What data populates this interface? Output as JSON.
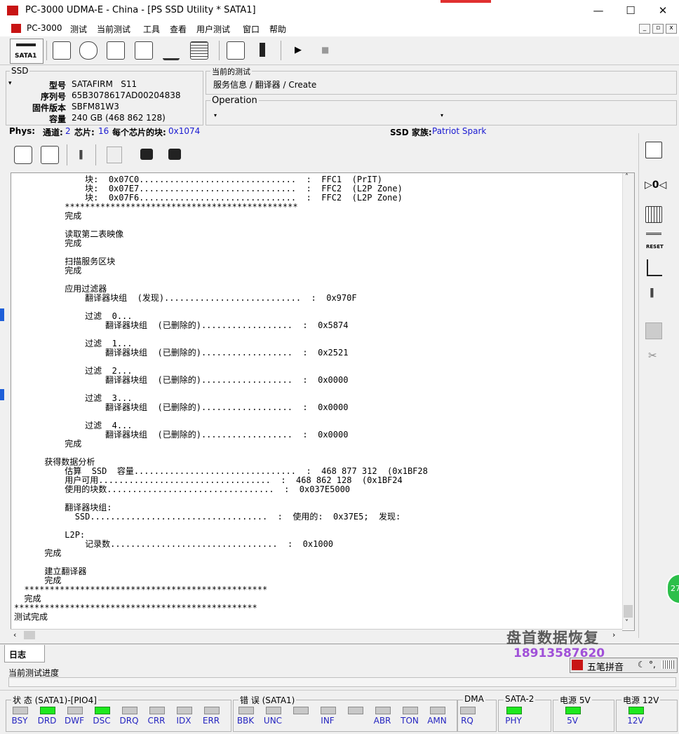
{
  "window": {
    "title": "PC-3000 UDMA-E - China - [PS SSD Utility * SATA1]",
    "minimize": "—",
    "maximize": "☐",
    "close": "✕"
  },
  "menu": [
    "PC-3000",
    "测试",
    "当前测试",
    "工具",
    "查看",
    "用户测试",
    "窗口",
    "帮助"
  ],
  "mdi_buttons": [
    "_",
    "▫",
    "x"
  ],
  "toolbar": {
    "port_label": "SATA1",
    "play": "▶",
    "stop": "■"
  },
  "ssd": {
    "group_label": "SSD",
    "fields": [
      {
        "label": "型号",
        "value": "SATAFIRM   S11"
      },
      {
        "label": "序列号",
        "value": "65B3078617AD00204838"
      },
      {
        "label": "固件版本",
        "value": "SBFM81W3"
      },
      {
        "label": "容量",
        "value": "240 GB (468 862 128)"
      }
    ]
  },
  "current_test": {
    "label": "当前的测试",
    "value": "服务信息 / 翻译器 / Create"
  },
  "operation": {
    "label": "Operation",
    "value": ""
  },
  "phys": {
    "label": "Phys:",
    "channels_label": "通道:",
    "channels": "2",
    "chips_label": "芯片:",
    "chips": "16",
    "blocks_label": "每个芯片的块:",
    "blocks": "0x1074",
    "family_label": "SSD 家族:",
    "family": "Patriot Spark"
  },
  "log_lines": [
    "              块:  0x07C0...............................  :  FFC1  (PrIT)",
    "              块:  0x07E7...............................  :  FFC2  (L2P Zone)",
    "              块:  0x07F6...............................  :  FFC2  (L2P Zone)",
    "          **********************************************",
    "          完成",
    "",
    "          读取第二表映像",
    "          完成",
    "",
    "          扫描服务区块",
    "          完成",
    "",
    "          应用过滤器",
    "              翻译器块组  (发现)...........................  :  0x970F",
    "",
    "              过滤  0...",
    "                  翻译器块组  (已删除的)..................  :  0x5874",
    "",
    "              过滤  1...",
    "                  翻译器块组  (已删除的)..................  :  0x2521",
    "",
    "              过滤  2...",
    "                  翻译器块组  (已删除的)..................  :  0x0000",
    "",
    "              过滤  3...",
    "                  翻译器块组  (已删除的)..................  :  0x0000",
    "",
    "              过滤  4...",
    "                  翻译器块组  (已删除的)..................  :  0x0000",
    "          完成",
    "",
    "      获得数据分析",
    "          估算  SSD  容量................................  :  468 877 312  (0x1BF28",
    "          用户可用..................................  :  468 862 128  (0x1BF24",
    "          使用的块数.................................  :  0x037E5000",
    "",
    "          翻译器块组:",
    "            SSD...................................  :  使用的:  0x37E5;  发现:",
    "",
    "          L2P:",
    "              记录数.................................  :  0x1000",
    "      完成",
    "",
    "      建立翻译器",
    "      完成",
    "  ************************************************",
    "  完成",
    "************************************************",
    "测试完成"
  ],
  "watermark": {
    "name": "盘首数据恢复",
    "phone": "18913587620"
  },
  "ime": {
    "label": "五笔拼音"
  },
  "tabs": {
    "log": "日志"
  },
  "progress": {
    "label": "当前测试进度",
    "value": 0
  },
  "status_groups": [
    {
      "title": "状 态 (SATA1)-[PIO4]",
      "leds": [
        {
          "name": "BSY",
          "on": false
        },
        {
          "name": "DRD",
          "on": true
        },
        {
          "name": "DWF",
          "on": false
        },
        {
          "name": "DSC",
          "on": true
        },
        {
          "name": "DRQ",
          "on": false
        },
        {
          "name": "CRR",
          "on": false
        },
        {
          "name": "IDX",
          "on": false
        },
        {
          "name": "ERR",
          "on": false
        }
      ]
    },
    {
      "title": "错 误 (SATA1)",
      "leds": [
        {
          "name": "BBK",
          "on": false
        },
        {
          "name": "UNC",
          "on": false
        },
        {
          "name": "",
          "on": false
        },
        {
          "name": "INF",
          "on": false
        },
        {
          "name": "",
          "on": false
        },
        {
          "name": "ABR",
          "on": false
        },
        {
          "name": "TON",
          "on": false
        },
        {
          "name": "AMN",
          "on": false
        }
      ]
    },
    {
      "title": "DMA",
      "leds": [
        {
          "name": "RQ",
          "on": false
        }
      ]
    },
    {
      "title": "SATA-2",
      "leds": [
        {
          "name": "PHY",
          "on": true
        }
      ]
    },
    {
      "title": "电源 5V",
      "leds": [
        {
          "name": "5V",
          "on": true
        }
      ]
    },
    {
      "title": "电源 12V",
      "leds": [
        {
          "name": "12V",
          "on": true
        }
      ]
    }
  ],
  "badge": "27",
  "colors": {
    "accent_red": "#c81414",
    "led_on": "#1ee81e",
    "label_blue": "#2424c0"
  }
}
